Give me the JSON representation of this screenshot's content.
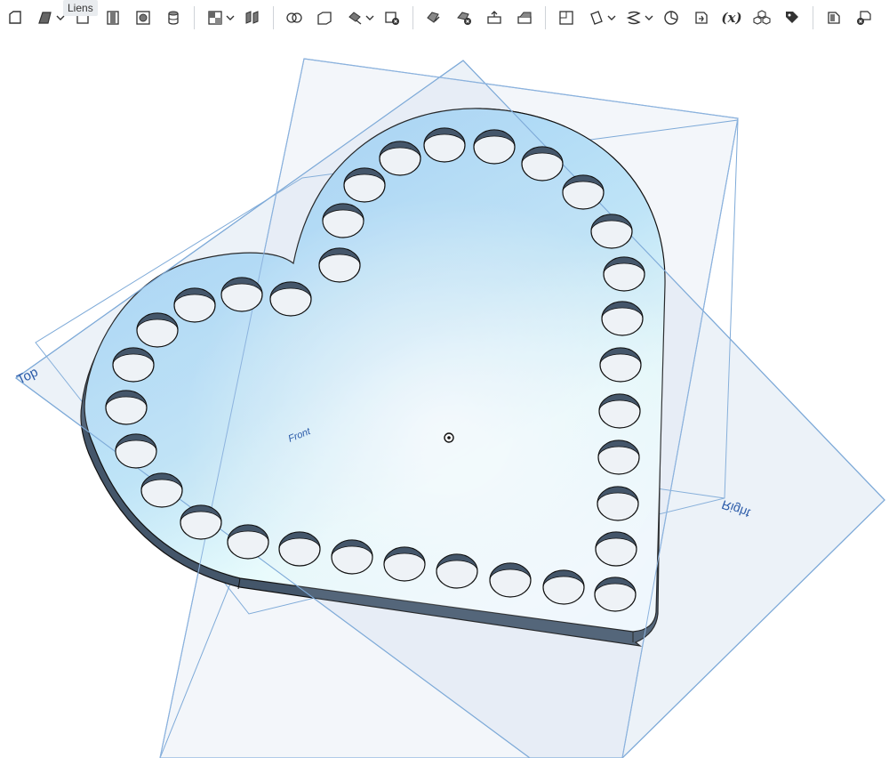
{
  "tooltip": {
    "text": "Liens"
  },
  "viewport": {
    "planes": {
      "top": "Top",
      "front": "Front",
      "right": "Right"
    }
  },
  "toolbar": {
    "icons": [
      "new-sketch-icon",
      "extrude-icon",
      "revolve-icon",
      "sweep-icon",
      "loft-icon",
      "thicken-icon",
      "fillet-icon",
      "chamfer-icon",
      "draft-icon",
      "shell-icon",
      "boolean-icon",
      "split-icon",
      "transform-icon",
      "delete-part-icon",
      "modify-fillet-icon",
      "delete-face-icon",
      "move-face-icon",
      "replace-face-icon",
      "plane-icon",
      "mate-connector-icon",
      "helix-icon",
      "mirror-icon",
      "variable-icon",
      "assembly-icon",
      "tag-icon",
      "sheet-metal-icon",
      "delete-icon"
    ],
    "formula_label": "(x)"
  },
  "colors": {
    "part_face": "#aed8f6",
    "plane_fill": "#dbe6f1",
    "plane_edge": "#7eaad8",
    "plane_label": "#2a5aa8",
    "wall": "#44566a"
  }
}
